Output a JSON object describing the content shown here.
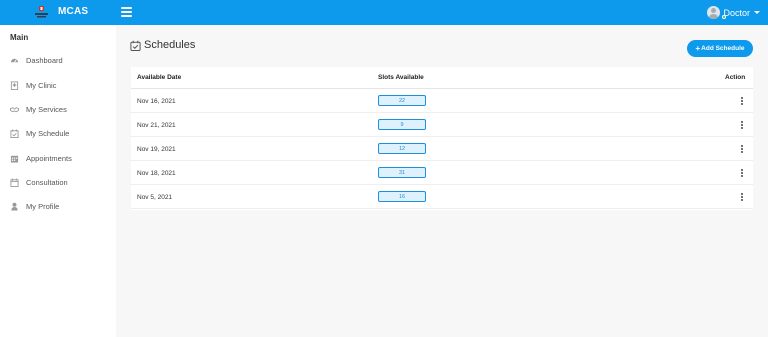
{
  "brand": {
    "name": "MCAS"
  },
  "user": {
    "name": "Doctor"
  },
  "sidebar": {
    "title": "Main",
    "items": [
      {
        "label": "Dashboard",
        "icon": "dashboard-icon"
      },
      {
        "label": "My Clinic",
        "icon": "clinic-icon"
      },
      {
        "label": "My Services",
        "icon": "handshake-icon"
      },
      {
        "label": "My Schedule",
        "icon": "calendar-check-icon"
      },
      {
        "label": "Appointments",
        "icon": "calendar-icon"
      },
      {
        "label": "Consultation",
        "icon": "calendar-blank-icon"
      },
      {
        "label": "My Profile",
        "icon": "user-icon"
      }
    ]
  },
  "page": {
    "title": "Schedules",
    "add_button": "Add Schedule"
  },
  "table": {
    "headers": {
      "date": "Available Date",
      "slots": "Slots Available",
      "action": "Action"
    },
    "rows": [
      {
        "date": "Nov 16, 2021",
        "slots": "22"
      },
      {
        "date": "Nov 21, 2021",
        "slots": "9"
      },
      {
        "date": "Nov 19, 2021",
        "slots": "12"
      },
      {
        "date": "Nov 18, 2021",
        "slots": "31"
      },
      {
        "date": "Nov 5, 2021",
        "slots": "16"
      }
    ]
  },
  "colors": {
    "primary": "#0d99ec",
    "badge_border": "#1b8fe0",
    "badge_bg": "#dff1fd",
    "online": "#27c24c"
  }
}
